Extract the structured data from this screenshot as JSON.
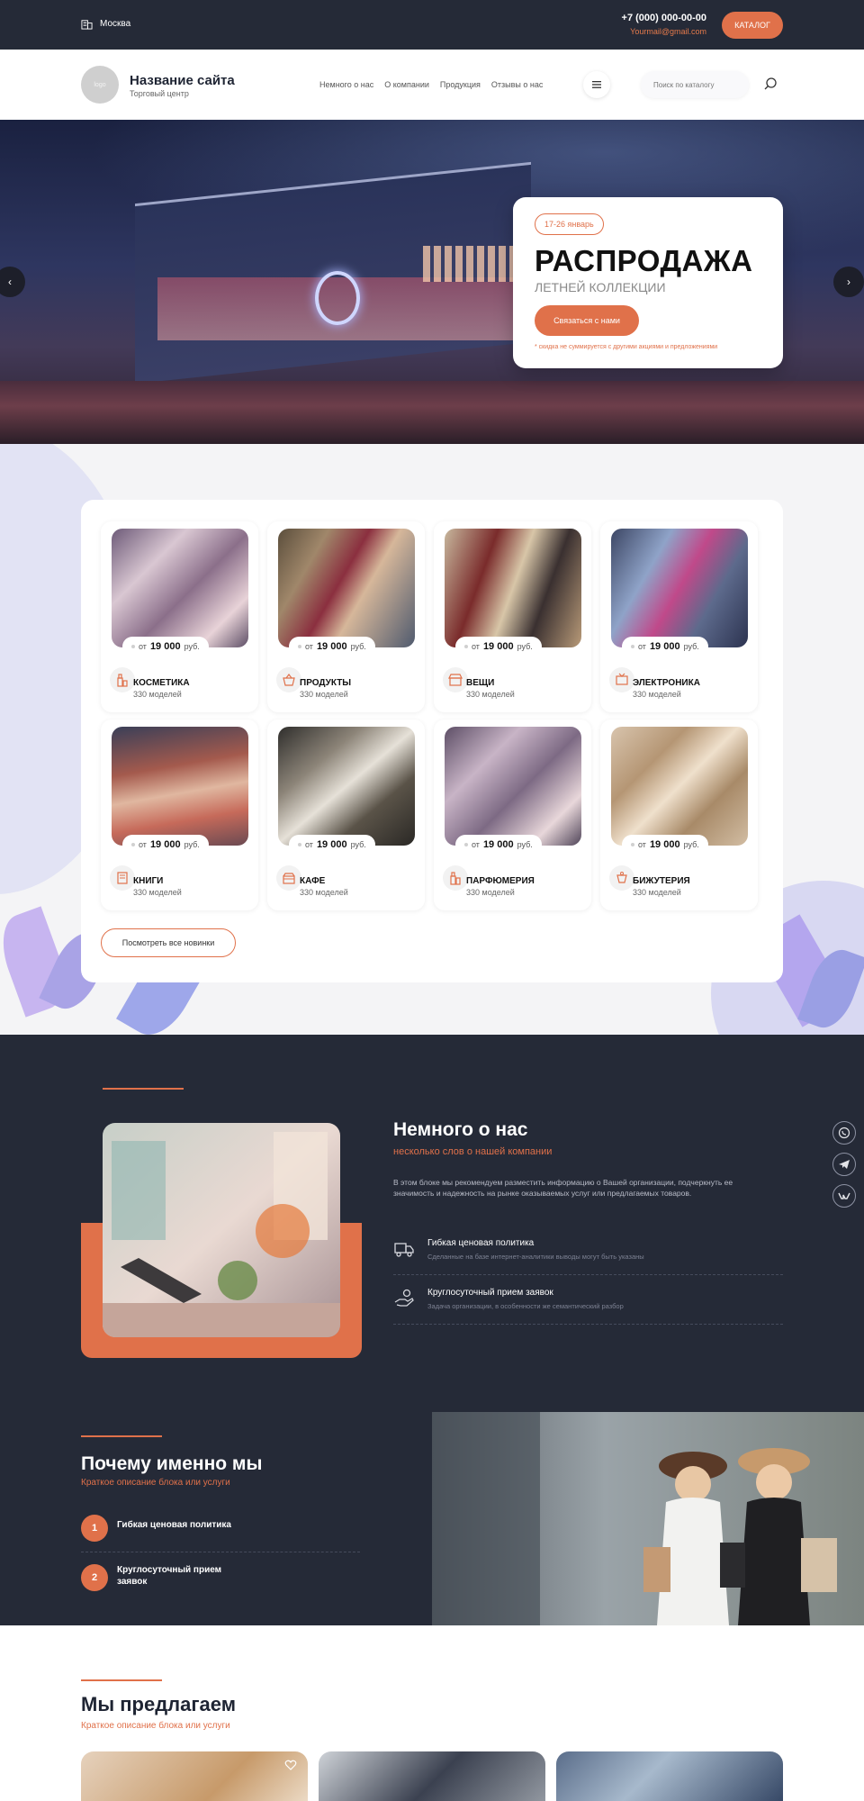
{
  "topbar": {
    "city": "Москва",
    "phone": "+7 (000) 000-00-00",
    "email": "Yourmail@gmail.com",
    "catalog_button": "КАТАЛОГ"
  },
  "header": {
    "logo_text": "logo",
    "site_name": "Название сайта",
    "site_sub": "Торговый центр",
    "nav": [
      "Немного о нас",
      "О компании",
      "Продукция",
      "Отзывы о нас"
    ],
    "search_placeholder": "Поиск по каталогу"
  },
  "hero": {
    "date": "17-26 январь",
    "title": "РАСПРОДАЖА",
    "subtitle": "ЛЕТНЕЙ КОЛЛЕКЦИИ",
    "button": "Связаться с нами",
    "note": "* скидка не суммируется с другими акциями и предложениями"
  },
  "categories": {
    "price_prefix": "от",
    "price_currency": "руб.",
    "items": [
      {
        "name": "КОСМЕТИКА",
        "count": "330 моделей",
        "price": "19 000"
      },
      {
        "name": "ПРОДУКТЫ",
        "count": "330 моделей",
        "price": "19 000"
      },
      {
        "name": "ВЕЩИ",
        "count": "330 моделей",
        "price": "19 000"
      },
      {
        "name": "ЭЛЕКТРОНИКА",
        "count": "330 моделей",
        "price": "19 000"
      },
      {
        "name": "КНИГИ",
        "count": "330 моделей",
        "price": "19 000"
      },
      {
        "name": "КАФЕ",
        "count": "330 моделей",
        "price": "19 000"
      },
      {
        "name": "ПАРФЮМЕРИЯ",
        "count": "330 моделей",
        "price": "19 000"
      },
      {
        "name": "БИЖУТЕРИЯ",
        "count": "330 моделей",
        "price": "19 000"
      }
    ],
    "all_button": "Посмотреть все новинки"
  },
  "about": {
    "title": "Немного о нас",
    "subtitle": "несколько слов о нашей компании",
    "text": "В этом блоке мы рекомендуем разместить информацию о Вашей организации, подчеркнуть ее значимость и надежность на рынке оказываемых услуг или предлагаемых товаров.",
    "features": [
      {
        "title": "Гибкая ценовая политика",
        "sub": "Сделанные на базе интернет-аналитики выводы могут быть указаны"
      },
      {
        "title": "Круглосуточный прием заявок",
        "sub": "Задача организации, в особенности же семантический разбор"
      }
    ]
  },
  "why": {
    "title": "Почему именно мы",
    "subtitle": "Краткое описание блока или услуги",
    "items": [
      {
        "num": "1",
        "label": "Гибкая ценовая политика"
      },
      {
        "num": "2",
        "label": "Круглосуточный прием заявок"
      }
    ]
  },
  "offers": {
    "title": "Мы предлагаем",
    "subtitle": "Краткое описание блока или услуги"
  },
  "colors": {
    "accent": "#e0714a",
    "dark": "#252a37"
  }
}
